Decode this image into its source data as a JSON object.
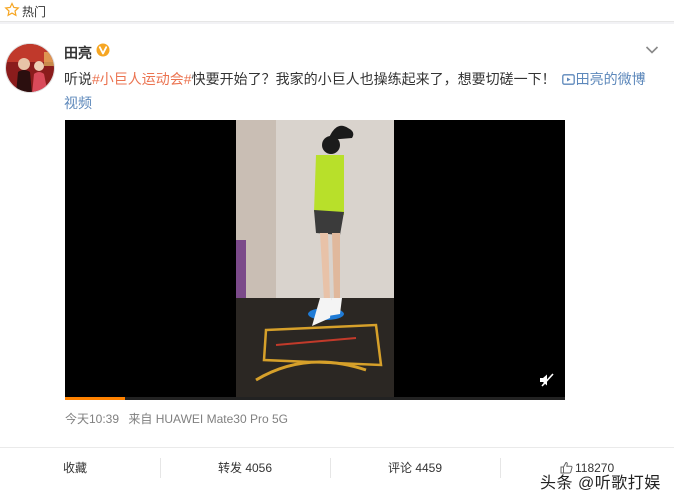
{
  "hot_bar": {
    "icon": "star-icon",
    "label": "热门"
  },
  "post": {
    "username": "田亮",
    "verified_icon": "verified-badge-icon",
    "text_prefix": "听说",
    "topic": "#小巨人运动会#",
    "text_body": "快要开始了？我家的小巨人也操练起来了，想要切磋一下！",
    "video_link_icon": "video-link-icon",
    "video_link_text": "田亮的微博视频",
    "video": {
      "progress": 0.12,
      "mute_icon": "speaker-muted-icon"
    },
    "meta": {
      "time": "今天10:39",
      "source": "来自 HUAWEI Mate30 Pro 5G"
    }
  },
  "actions": {
    "favorite": "收藏",
    "repost": "转发 4056",
    "comment": "评论 4459",
    "like_icon": "thumbs-up-icon",
    "like_count": "118270"
  },
  "watermark": "头条 @听歌打娱",
  "colors": {
    "topic": "#eb7350",
    "link": "#5d88bb",
    "accent": "#ff8200",
    "verified": "#f6a623"
  }
}
